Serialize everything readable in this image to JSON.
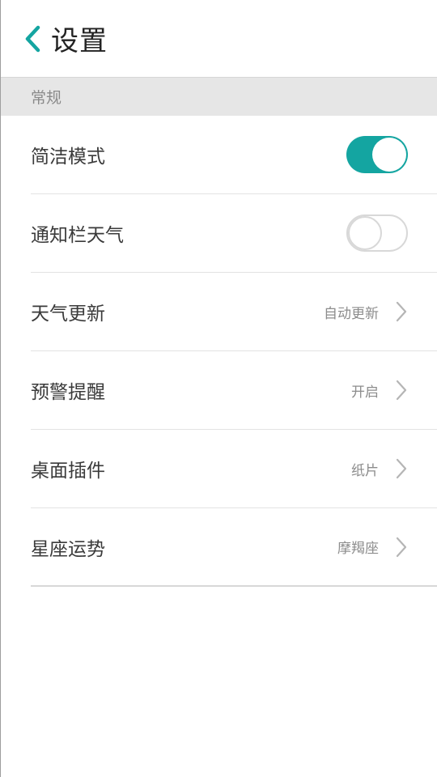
{
  "header": {
    "title": "设置",
    "back_icon": "chevron-left-icon",
    "accent_color": "#14a5a1"
  },
  "section": {
    "title": "常规"
  },
  "rows": [
    {
      "label": "简洁模式",
      "type": "toggle",
      "state": "on"
    },
    {
      "label": "通知栏天气",
      "type": "toggle",
      "state": "off"
    },
    {
      "label": "天气更新",
      "type": "link",
      "value": "自动更新"
    },
    {
      "label": "预警提醒",
      "type": "link",
      "value": "开启"
    },
    {
      "label": "桌面插件",
      "type": "link",
      "value": "纸片"
    },
    {
      "label": "星座运势",
      "type": "link",
      "value": "摩羯座"
    }
  ]
}
